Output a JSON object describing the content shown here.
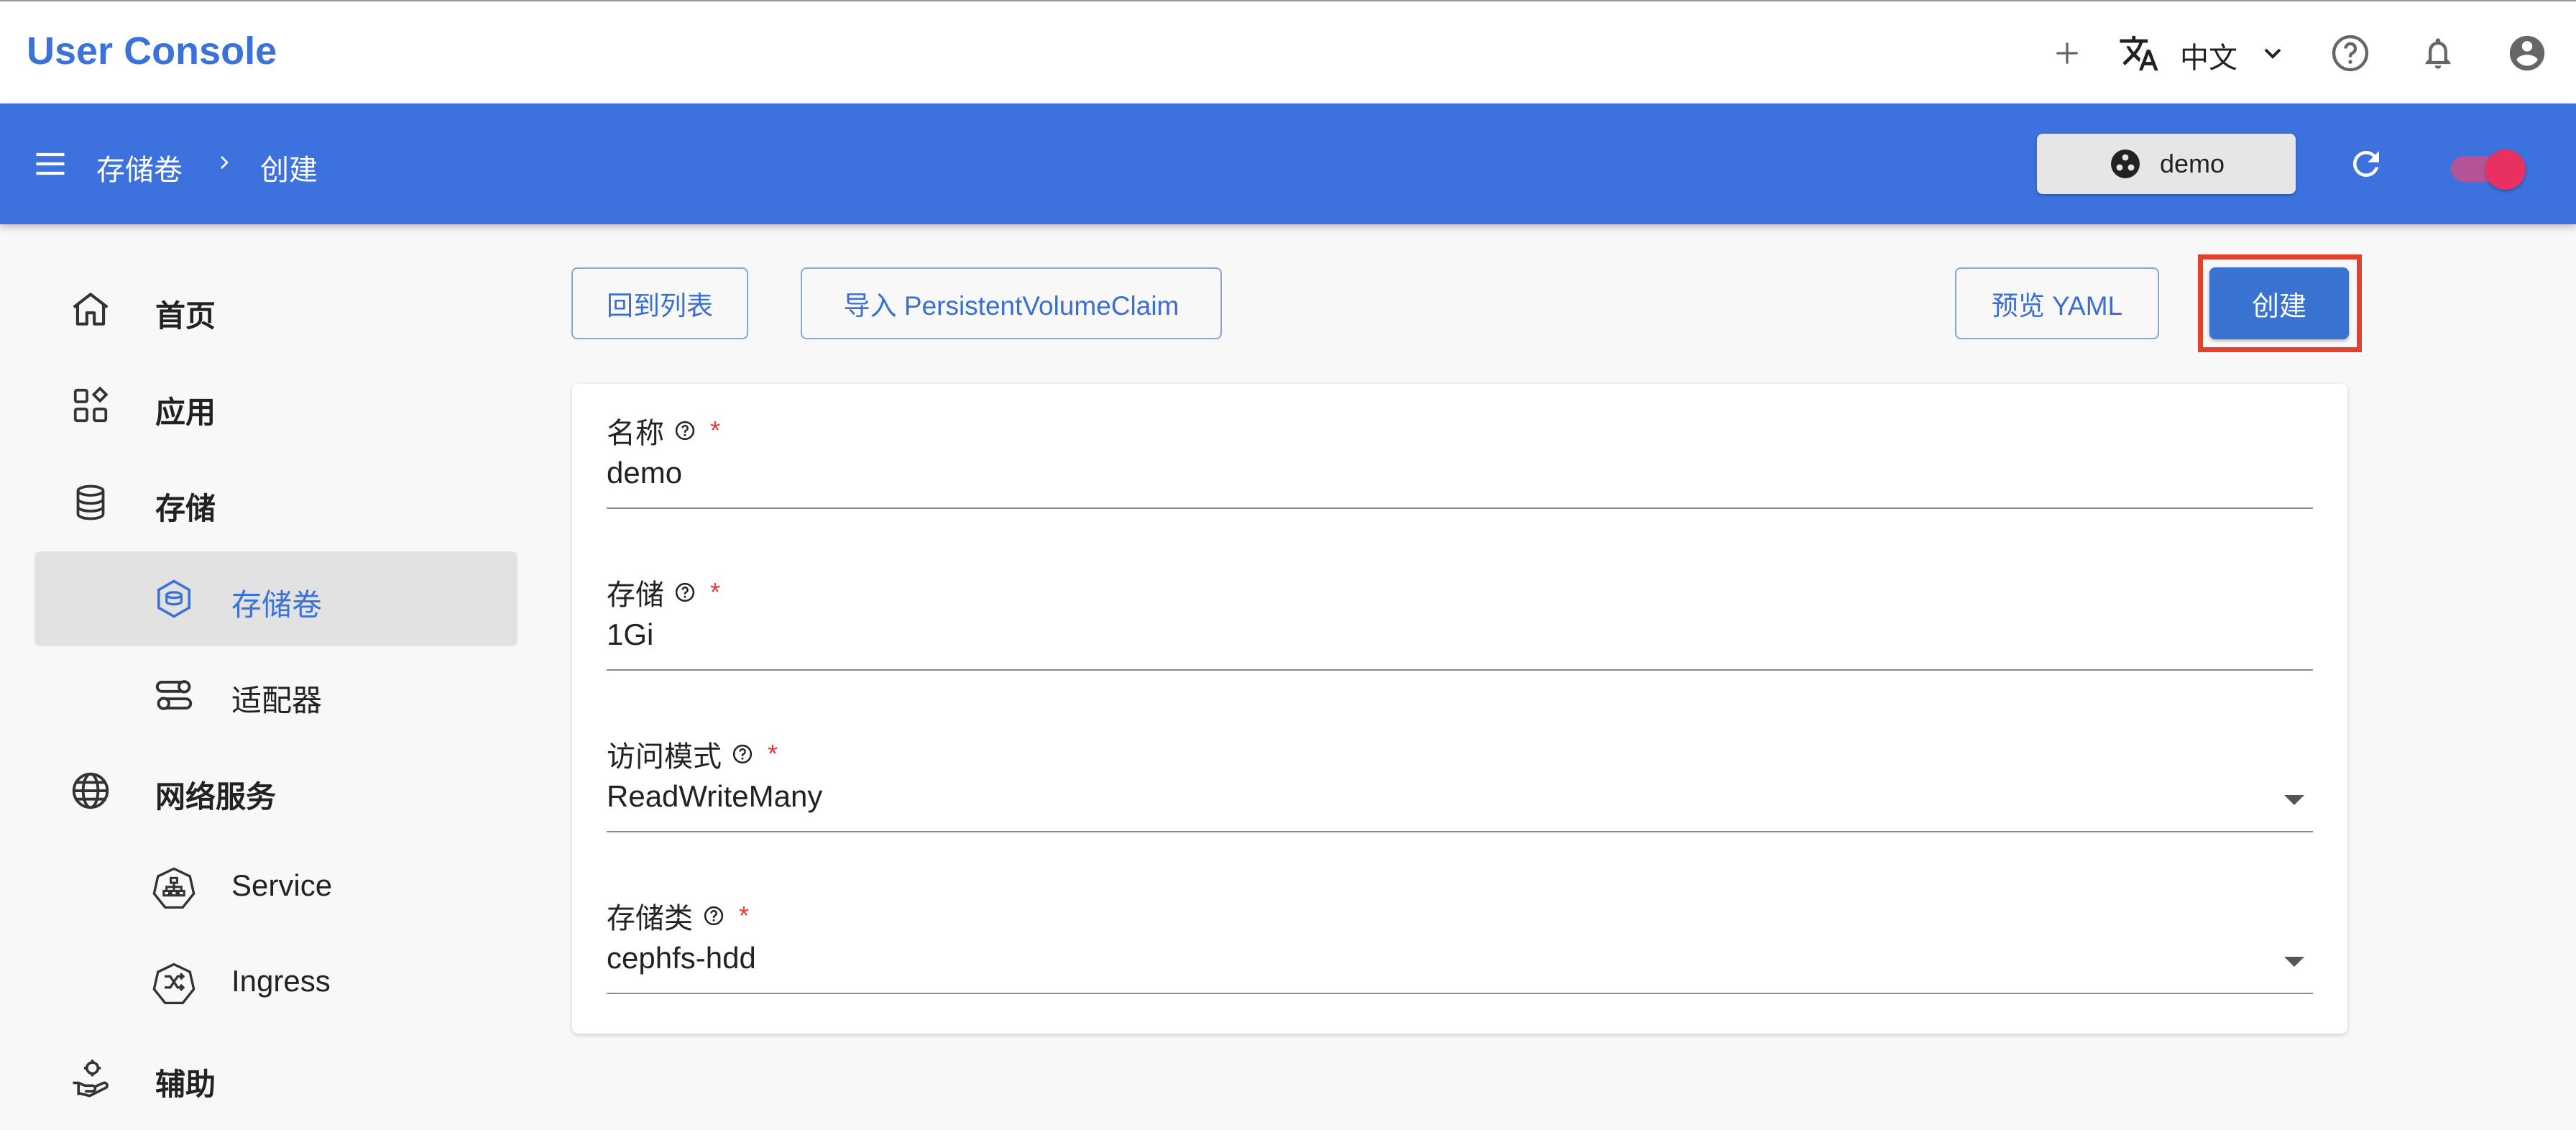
{
  "app": {
    "title": "User Console"
  },
  "topbar": {
    "language": "中文",
    "icons": [
      "add-icon",
      "translate-icon",
      "chevron-down-icon",
      "help-icon",
      "bell-icon",
      "account-icon"
    ]
  },
  "header": {
    "breadcrumb": [
      "存储卷",
      "创建"
    ],
    "namespace": "demo"
  },
  "sidebar": {
    "items": [
      {
        "label": "首页",
        "icon": "home-icon",
        "level": 1
      },
      {
        "label": "应用",
        "icon": "apps-icon",
        "level": 1
      },
      {
        "label": "存储",
        "icon": "database-icon",
        "level": 1
      },
      {
        "label": "存储卷",
        "icon": "volume-icon",
        "level": 2,
        "active": true
      },
      {
        "label": "适配器",
        "icon": "adapter-icon",
        "level": 2
      },
      {
        "label": "网络服务",
        "icon": "globe-icon",
        "level": 1
      },
      {
        "label": "Service",
        "icon": "service-icon",
        "level": 2
      },
      {
        "label": "Ingress",
        "icon": "ingress-icon",
        "level": 2
      },
      {
        "label": "辅助",
        "icon": "helper-icon",
        "level": 1
      }
    ]
  },
  "actions": {
    "back": "回到列表",
    "import": "导入 PersistentVolumeClaim",
    "preview": "预览 YAML",
    "create": "创建"
  },
  "form": {
    "fields": [
      {
        "label": "名称",
        "value": "demo",
        "required": true,
        "type": "text"
      },
      {
        "label": "存储",
        "value": "1Gi",
        "required": true,
        "type": "text"
      },
      {
        "label": "访问模式",
        "value": "ReadWriteMany",
        "required": true,
        "type": "select"
      },
      {
        "label": "存储类",
        "value": "cephfs-hdd",
        "required": true,
        "type": "select"
      }
    ],
    "required_mark": "*"
  },
  "colors": {
    "brand": "#3a72d8",
    "header": "#3d71de",
    "highlight": "#e2412d",
    "toggle": "#e83162"
  }
}
